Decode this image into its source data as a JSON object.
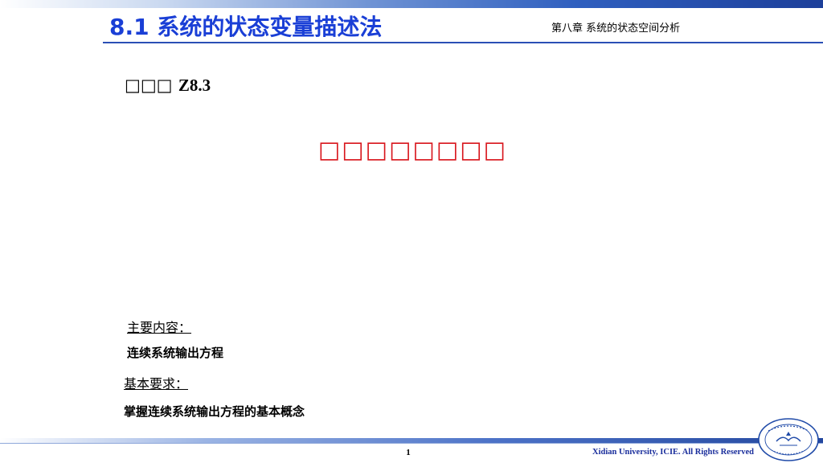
{
  "header": {
    "title": "8.1 系统的状态变量描述法",
    "chapter": "第八章 系统的状态空间分析"
  },
  "section": {
    "code_prefix": "□□□",
    "code": "Z8.3",
    "heading": "□□□□□□□□"
  },
  "content": {
    "main_label": "主要内容：",
    "main_text": "连续系统输出方程",
    "requirement_label": "基本要求：",
    "requirement_text": "掌握连续系统输出方程的基本概念"
  },
  "footer": {
    "page_number": "1",
    "copyright": "Xidian University, ICIE. All Rights Reserved"
  },
  "colors": {
    "title_blue": "#1a3fd6",
    "rule_blue": "#2b4fb5",
    "heading_red": "#d8141b",
    "footer_text_blue": "#1a2e9c"
  },
  "icons": {
    "logo": "university-seal-icon"
  }
}
